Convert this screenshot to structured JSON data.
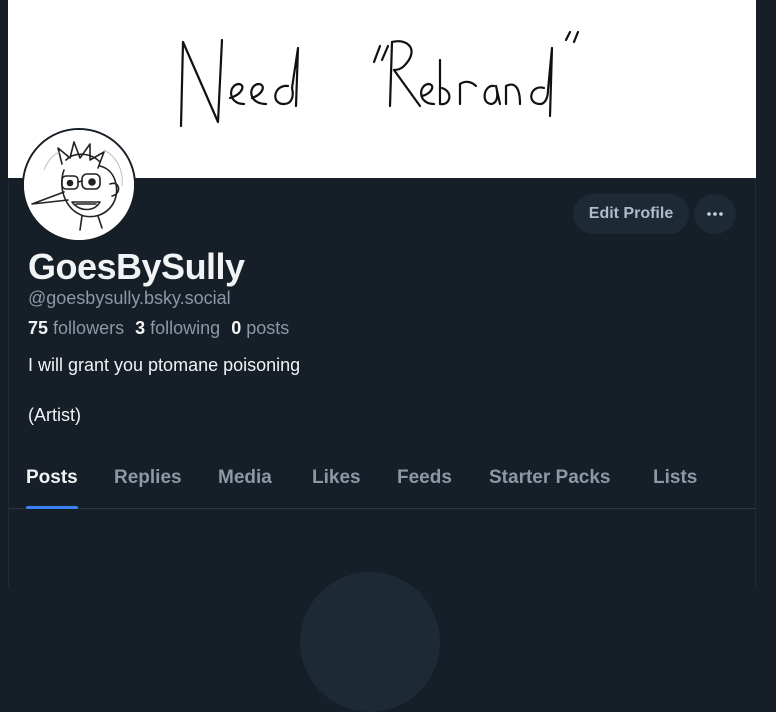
{
  "banner": {
    "text": "Need “Rebrand”"
  },
  "profile": {
    "display_name": "GoesBySully",
    "handle": "@goesbysully.bsky.social",
    "followers_count": "75",
    "followers_label": "followers",
    "following_count": "3",
    "following_label": "following",
    "posts_count": "0",
    "posts_label": "posts",
    "bio_line1": "I will grant you ptomane poisoning",
    "bio_line2": "(Artist)"
  },
  "actions": {
    "edit_profile_label": "Edit Profile",
    "more_icon": "ellipsis-icon"
  },
  "tabs": [
    {
      "label": "Posts",
      "active": true
    },
    {
      "label": "Replies"
    },
    {
      "label": "Media"
    },
    {
      "label": "Likes"
    },
    {
      "label": "Feeds"
    },
    {
      "label": "Starter Packs"
    },
    {
      "label": "Lists"
    }
  ],
  "colors": {
    "background": "#161e27",
    "accent": "#3b82f6",
    "button_bg": "#1e2936",
    "text_primary": "#f1f3f5",
    "text_secondary": "#8b98a5"
  }
}
